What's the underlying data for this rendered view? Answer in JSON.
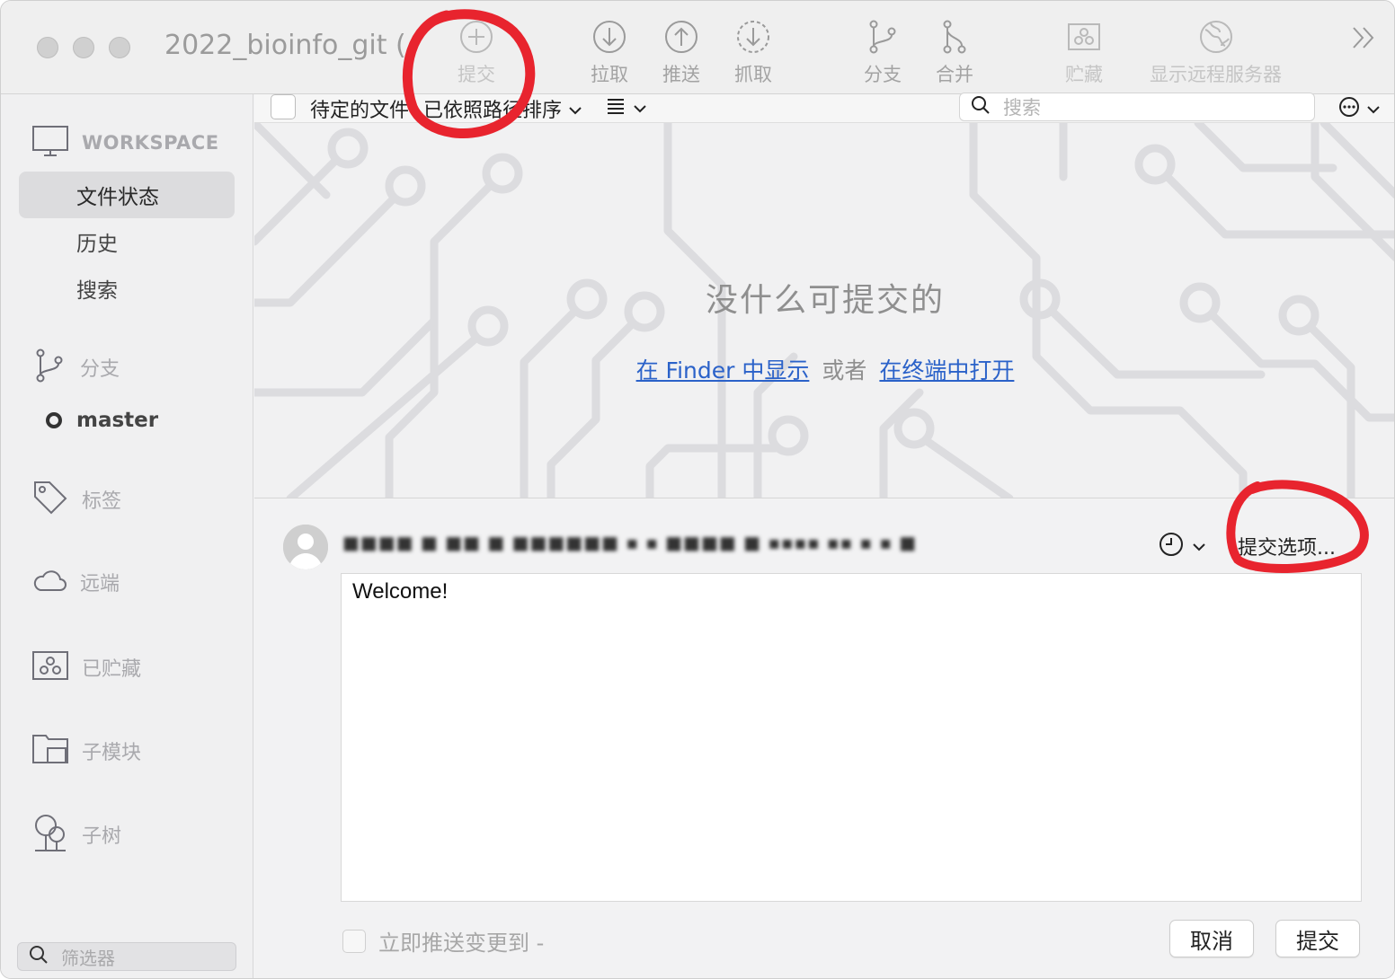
{
  "window": {
    "title": "2022_bioinfo_git (..."
  },
  "toolbar": {
    "commit": "提交",
    "pull": "拉取",
    "push": "推送",
    "fetch": "抓取",
    "branch": "分支",
    "merge": "合并",
    "stash": "贮藏",
    "show_remote": "显示远程服务器",
    "more_icon": "chevron-double-right-icon"
  },
  "sidebar": {
    "workspace_label": "WORKSPACE",
    "items": [
      {
        "label": "文件状态",
        "selected": true
      },
      {
        "label": "历史",
        "selected": false
      },
      {
        "label": "搜索",
        "selected": false
      }
    ],
    "sections": {
      "branches": "分支",
      "tags": "标签",
      "remotes": "远端",
      "stashes": "已贮藏",
      "submodules": "子模块",
      "subtrees": "子树"
    },
    "current_branch": "master",
    "filter_placeholder": "筛选器"
  },
  "subbar": {
    "pending_label": "待定的文件",
    "sort_label": "已依照路径排序",
    "search_placeholder": "搜索"
  },
  "empty_state": {
    "title": "没什么可提交的",
    "finder_link": "在 Finder 中显示",
    "or_text": "或者",
    "terminal_link": "在终端中打开"
  },
  "commit": {
    "author": "■■■■ ■ ■■ ■ ■■■■■■ ▪ ▪ ■■■■ ■ ▪▪▪▪ ▪▪ ▪ ▪ ■",
    "options_label": "提交选项...",
    "message": "Welcome!",
    "push_label": "立即推送变更到 -",
    "cancel_label": "取消",
    "commit_label": "提交"
  },
  "colors": {
    "link": "#2b62c9",
    "annotation": "#e8242e"
  }
}
